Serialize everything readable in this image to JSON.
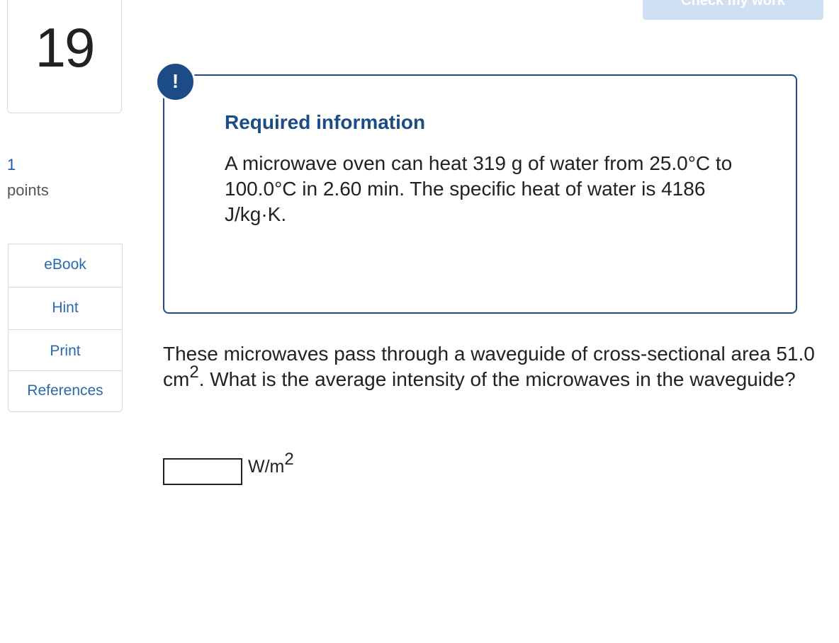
{
  "header": {
    "check_label": "Check my work"
  },
  "question_meta": {
    "number": "19",
    "points_value": "1",
    "points_label": "points"
  },
  "sidebar": {
    "items": [
      {
        "label": "eBook"
      },
      {
        "label": "Hint"
      },
      {
        "label": "Print"
      },
      {
        "label": "References"
      }
    ]
  },
  "info": {
    "alert_glyph": "!",
    "title": "Required information",
    "text": "A microwave oven can heat 319 g of water from 25.0°C to 100.0°C in 2.60 min. The specific heat of water is 4186 J/kg·K."
  },
  "question": {
    "text_before": "These microwaves pass through a waveguide of cross-sectional area 51.0 cm",
    "sup": "2",
    "text_after": ". What is the average intensity of the microwaves in the waveguide?"
  },
  "answer": {
    "value": "",
    "unit_base": "W/m",
    "unit_sup": "2"
  },
  "colors": {
    "accent": "#1c4c86",
    "link": "#2a69ad",
    "check_button_bg": "#cfe0f2"
  }
}
